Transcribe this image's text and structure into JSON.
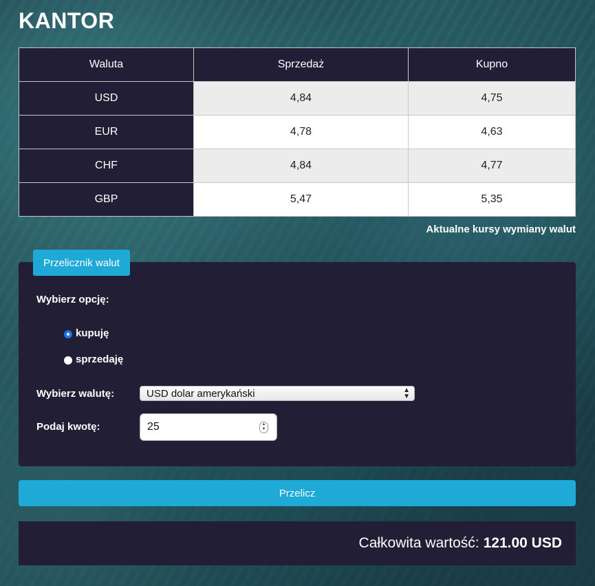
{
  "header": {
    "title": "KANTOR"
  },
  "rates_table": {
    "columns": [
      "Waluta",
      "Sprzedaż",
      "Kupno"
    ],
    "rows": [
      {
        "currency": "USD",
        "sell": "4,84",
        "buy": "4,75"
      },
      {
        "currency": "EUR",
        "sell": "4,78",
        "buy": "4,63"
      },
      {
        "currency": "CHF",
        "sell": "4,84",
        "buy": "4,77"
      },
      {
        "currency": "GBP",
        "sell": "5,47",
        "buy": "5,35"
      }
    ],
    "caption": "Aktualne kursy wymiany walut"
  },
  "converter": {
    "tab_label": "Przelicznik walut",
    "option_label": "Wybierz opcję:",
    "radio_options": [
      {
        "label": "kupuję",
        "checked": true
      },
      {
        "label": "sprzedaję",
        "checked": false
      }
    ],
    "currency_label": "Wybierz walutę:",
    "currency_selected": "USD dolar amerykański",
    "amount_label": "Podaj kwotę:",
    "amount_value": "25"
  },
  "calculate_button": {
    "label": "Przelicz"
  },
  "result": {
    "prefix": "Całkowita wartość:",
    "amount": "121.00 USD"
  },
  "colors": {
    "panel_bg": "#211e35",
    "accent": "#1fa9d6",
    "radio_checked": "#1a73e8"
  }
}
